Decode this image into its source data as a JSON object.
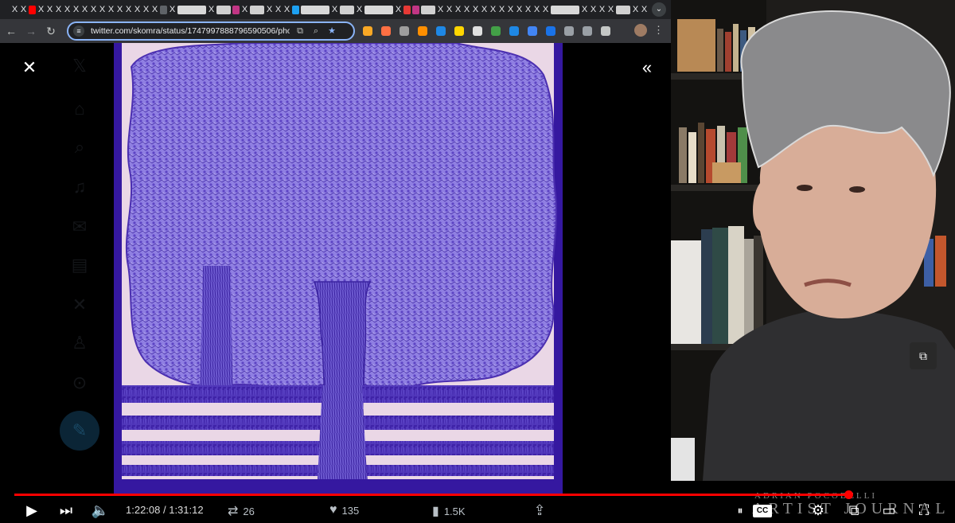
{
  "browser": {
    "url": "twitter.com/skomra/status/1747997888796590506/photo/1",
    "new_tab_label": "+",
    "tab_x_label": "X",
    "tabs_marks": [
      "x",
      "x",
      "yt",
      "x",
      "x",
      "x",
      "x",
      "x",
      "x",
      "x",
      "x",
      "x",
      "x",
      "x",
      "x",
      "x",
      "x",
      "gray",
      "x",
      "wide2",
      "x",
      "wide",
      "insta",
      "x",
      "wide",
      "x",
      "x",
      "x",
      "blue",
      "wide2",
      "x",
      "wide",
      "x",
      "wide2",
      "x",
      "red",
      "insta",
      "wide",
      "x",
      "x",
      "x",
      "x",
      "x",
      "x",
      "x",
      "x",
      "x",
      "x",
      "x",
      "x",
      "x",
      "wide2",
      "x",
      "x",
      "x",
      "x",
      "wide",
      "x",
      "x"
    ],
    "icons": {
      "back": "arrow-left-icon",
      "forward": "arrow-right-icon",
      "reload": "reload-icon",
      "star": "star-icon",
      "menu": "kebab-icon"
    },
    "extensions": [
      "#f9a825",
      "#ff7043",
      "#9e9e9e",
      "#ff8f00",
      "#1e88e5",
      "#ffd600",
      "#e0e0e0",
      "#43a047",
      "#1e88e5",
      "#4285f4",
      "#1a73e8",
      "#9aa0a6",
      "#9aa0a6",
      "#c4c7c5"
    ]
  },
  "twitter": {
    "close_icon": "close-icon",
    "collapse_icon": "double-chevron-right-icon",
    "image_colors": {
      "background": "#ead7e6",
      "ink": "#4b2fb0",
      "frame": "#3518a0"
    }
  },
  "player": {
    "time": "1:22:08 / 1:31:12",
    "progress_fraction": 0.9,
    "stats": {
      "reposts": "26",
      "likes": "135",
      "views": "1.5K"
    },
    "cc_label": "CC",
    "artist_name": "ADRIAN POCOBELLI",
    "artist_sign": "ARTIST JOURNAL",
    "accent": "#ff0000"
  }
}
